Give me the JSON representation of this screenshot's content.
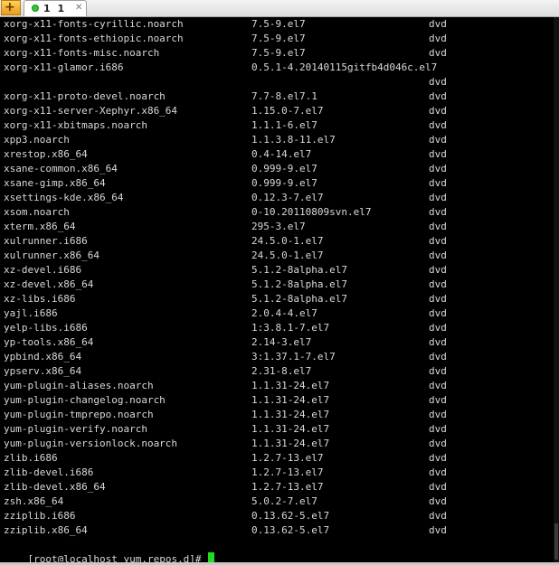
{
  "tabbar": {
    "new_tab_label": "+",
    "tab_title": "1 1",
    "close_label": "✕"
  },
  "terminal": {
    "rows": [
      {
        "name": "xorg-x11-fonts-cyrillic.noarch",
        "version": "7.5-9.el7",
        "repo": "dvd"
      },
      {
        "name": "xorg-x11-fonts-ethiopic.noarch",
        "version": "7.5-9.el7",
        "repo": "dvd"
      },
      {
        "name": "xorg-x11-fonts-misc.noarch",
        "version": "7.5-9.el7",
        "repo": "dvd"
      },
      {
        "name": "xorg-x11-glamor.i686",
        "version": "0.5.1-4.20140115gitfb4d046c.el7",
        "repo": ""
      },
      {
        "name": "",
        "version": "",
        "repo": "dvd"
      },
      {
        "name": "xorg-x11-proto-devel.noarch",
        "version": "7.7-8.el7.1",
        "repo": "dvd"
      },
      {
        "name": "xorg-x11-server-Xephyr.x86_64",
        "version": "1.15.0-7.el7",
        "repo": "dvd"
      },
      {
        "name": "xorg-x11-xbitmaps.noarch",
        "version": "1.1.1-6.el7",
        "repo": "dvd"
      },
      {
        "name": "xpp3.noarch",
        "version": "1.1.3.8-11.el7",
        "repo": "dvd"
      },
      {
        "name": "xrestop.x86_64",
        "version": "0.4-14.el7",
        "repo": "dvd"
      },
      {
        "name": "xsane-common.x86_64",
        "version": "0.999-9.el7",
        "repo": "dvd"
      },
      {
        "name": "xsane-gimp.x86_64",
        "version": "0.999-9.el7",
        "repo": "dvd"
      },
      {
        "name": "xsettings-kde.x86_64",
        "version": "0.12.3-7.el7",
        "repo": "dvd"
      },
      {
        "name": "xsom.noarch",
        "version": "0-10.20110809svn.el7",
        "repo": "dvd"
      },
      {
        "name": "xterm.x86_64",
        "version": "295-3.el7",
        "repo": "dvd"
      },
      {
        "name": "xulrunner.i686",
        "version": "24.5.0-1.el7",
        "repo": "dvd"
      },
      {
        "name": "xulrunner.x86_64",
        "version": "24.5.0-1.el7",
        "repo": "dvd"
      },
      {
        "name": "xz-devel.i686",
        "version": "5.1.2-8alpha.el7",
        "repo": "dvd"
      },
      {
        "name": "xz-devel.x86_64",
        "version": "5.1.2-8alpha.el7",
        "repo": "dvd"
      },
      {
        "name": "xz-libs.i686",
        "version": "5.1.2-8alpha.el7",
        "repo": "dvd"
      },
      {
        "name": "yajl.i686",
        "version": "2.0.4-4.el7",
        "repo": "dvd"
      },
      {
        "name": "yelp-libs.i686",
        "version": "1:3.8.1-7.el7",
        "repo": "dvd"
      },
      {
        "name": "yp-tools.x86_64",
        "version": "2.14-3.el7",
        "repo": "dvd"
      },
      {
        "name": "ypbind.x86_64",
        "version": "3:1.37.1-7.el7",
        "repo": "dvd"
      },
      {
        "name": "ypserv.x86_64",
        "version": "2.31-8.el7",
        "repo": "dvd"
      },
      {
        "name": "yum-plugin-aliases.noarch",
        "version": "1.1.31-24.el7",
        "repo": "dvd"
      },
      {
        "name": "yum-plugin-changelog.noarch",
        "version": "1.1.31-24.el7",
        "repo": "dvd"
      },
      {
        "name": "yum-plugin-tmprepo.noarch",
        "version": "1.1.31-24.el7",
        "repo": "dvd"
      },
      {
        "name": "yum-plugin-verify.noarch",
        "version": "1.1.31-24.el7",
        "repo": "dvd"
      },
      {
        "name": "yum-plugin-versionlock.noarch",
        "version": "1.1.31-24.el7",
        "repo": "dvd"
      },
      {
        "name": "zlib.i686",
        "version": "1.2.7-13.el7",
        "repo": "dvd"
      },
      {
        "name": "zlib-devel.i686",
        "version": "1.2.7-13.el7",
        "repo": "dvd"
      },
      {
        "name": "zlib-devel.x86_64",
        "version": "1.2.7-13.el7",
        "repo": "dvd"
      },
      {
        "name": "zsh.x86_64",
        "version": "5.0.2-7.el7",
        "repo": "dvd"
      },
      {
        "name": "zziplib.i686",
        "version": "0.13.62-5.el7",
        "repo": "dvd"
      },
      {
        "name": "zziplib.x86_64",
        "version": "0.13.62-5.el7",
        "repo": "dvd"
      }
    ],
    "prompt": "[root@localhost yum.repos.d]# "
  },
  "colors": {
    "text": "#d9d9d9",
    "cursor": "#22dd22",
    "status": "#2ec62e"
  },
  "icons": [
    "new-tab-icon",
    "status-dot-icon",
    "close-icon"
  ]
}
